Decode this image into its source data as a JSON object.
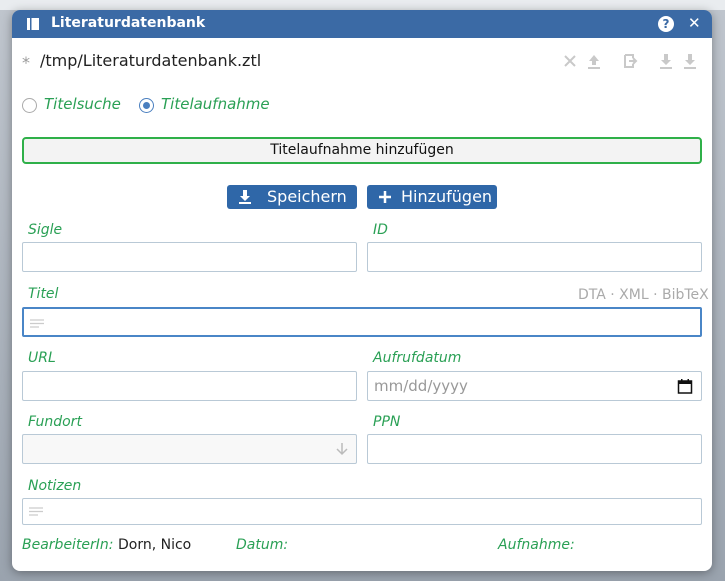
{
  "window": {
    "title": "Literaturdatenbank",
    "help_label": "?",
    "close_label": "✕"
  },
  "file": {
    "modified_marker": "*",
    "path": "/tmp/Literaturdatenbank.ztl"
  },
  "mode": {
    "options": [
      {
        "label": "Titelsuche",
        "selected": false
      },
      {
        "label": "Titelaufnahme",
        "selected": true
      }
    ]
  },
  "add_record_button": "Titelaufnahme hinzufügen",
  "actions": {
    "save_label": "Speichern",
    "add_label": "Hinzufügen"
  },
  "form": {
    "sigle": {
      "label": "Sigle",
      "value": ""
    },
    "id": {
      "label": "ID",
      "value": ""
    },
    "titel": {
      "label": "Titel",
      "value": ""
    },
    "formats": "DTA · XML · BibTeX",
    "url": {
      "label": "URL",
      "value": ""
    },
    "aufrufdatum": {
      "label": "Aufrufdatum",
      "placeholder": "mm/dd/yyyy"
    },
    "fundort": {
      "label": "Fundort",
      "value": ""
    },
    "ppn": {
      "label": "PPN",
      "value": ""
    },
    "notizen": {
      "label": "Notizen",
      "value": ""
    }
  },
  "footer": {
    "editor_label": "BearbeiterIn:",
    "editor_value": "Dorn, Nico",
    "date_label": "Datum:",
    "record_label": "Aufnahme:"
  },
  "colors": {
    "titlebar": "#3b6aa5",
    "label_green": "#2aa055",
    "button_blue": "#2f67a8",
    "add_border_green": "#2fb049"
  }
}
